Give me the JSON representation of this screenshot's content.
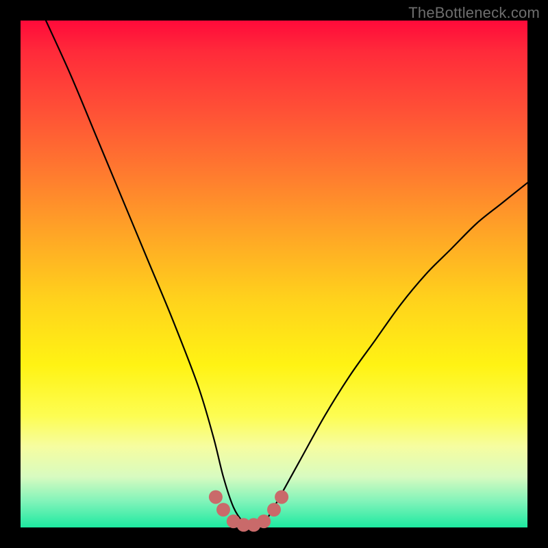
{
  "watermark": "TheBottleneck.com",
  "chart_data": {
    "type": "line",
    "title": "",
    "xlabel": "",
    "ylabel": "",
    "xlim": [
      0,
      100
    ],
    "ylim": [
      0,
      100
    ],
    "series": [
      {
        "name": "bottleneck-curve",
        "x": [
          5,
          10,
          15,
          20,
          25,
          30,
          35,
          38,
          40,
          42,
          44,
          46,
          48,
          50,
          55,
          60,
          65,
          70,
          75,
          80,
          85,
          90,
          95,
          100
        ],
        "values": [
          100,
          89,
          77,
          65,
          53,
          41,
          28,
          18,
          10,
          4,
          1,
          0,
          1,
          4,
          13,
          22,
          30,
          37,
          44,
          50,
          55,
          60,
          64,
          68
        ]
      }
    ],
    "markers": {
      "name": "trough-dots",
      "color": "#c96a6a",
      "radius": 10,
      "points_x": [
        38.5,
        40,
        42,
        44,
        46,
        48,
        50,
        51.5
      ],
      "points_y": [
        6,
        3.5,
        1.2,
        0.5,
        0.5,
        1.2,
        3.5,
        6
      ]
    }
  }
}
